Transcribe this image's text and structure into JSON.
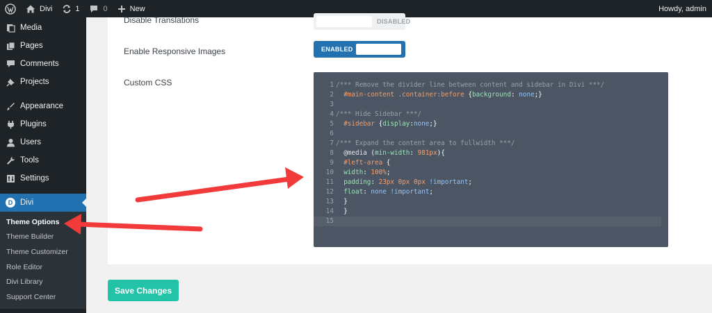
{
  "admin_bar": {
    "site_name": "Divi",
    "updates_count": "1",
    "comments_count": "0",
    "new_label": "New",
    "greeting": "Howdy, admin"
  },
  "sidebar": {
    "items": [
      {
        "label": "Media",
        "icon": "media-icon"
      },
      {
        "label": "Pages",
        "icon": "pages-icon"
      },
      {
        "label": "Comments",
        "icon": "comments-icon"
      },
      {
        "label": "Projects",
        "icon": "pin-icon"
      },
      {
        "label": "Appearance",
        "icon": "paintbrush-icon"
      },
      {
        "label": "Plugins",
        "icon": "plug-icon"
      },
      {
        "label": "Users",
        "icon": "user-icon"
      },
      {
        "label": "Tools",
        "icon": "wrench-icon"
      },
      {
        "label": "Settings",
        "icon": "settings-icon"
      }
    ],
    "current": {
      "label": "Divi",
      "icon": "divi-logo"
    },
    "divi_logo_letter": "D",
    "submenu": [
      "Theme Options",
      "Theme Builder",
      "Theme Customizer",
      "Role Editor",
      "Divi Library",
      "Support Center"
    ]
  },
  "options": {
    "disable_translations": {
      "label": "Disable Translations",
      "state": "DISABLED"
    },
    "responsive_images": {
      "label": "Enable Responsive Images",
      "state": "ENABLED"
    },
    "custom_css": {
      "label": "Custom CSS"
    }
  },
  "code_lines": [
    "/*** Remove the divider line between content and sidebar in Divi ***/",
    "  #main-content .container:before {background: none;}",
    "",
    "/*** Hide Sidebar ***/",
    "  #sidebar {display:none;}",
    "",
    "/*** Expand the content area to fullwidth ***/",
    "  @media (min-width: 981px){",
    "  #left-area {",
    "  width: 100%;",
    "  padding: 23px 0px 0px !important;",
    "  float: none !important;",
    "  }",
    "  }",
    ""
  ],
  "save_button": {
    "label": "Save Changes"
  },
  "colors": {
    "admin_dark": "#1d2327",
    "wp_blue": "#2271b1",
    "save_green": "#22c3a6",
    "editor_bg": "#4b5563",
    "annotation_red": "#f23a3a"
  }
}
